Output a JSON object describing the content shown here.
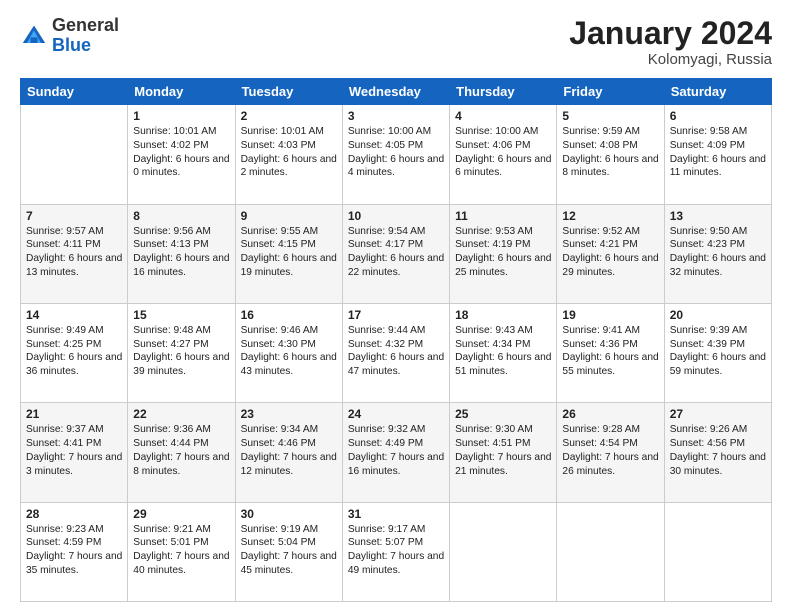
{
  "logo": {
    "general": "General",
    "blue": "Blue"
  },
  "title": "January 2024",
  "location": "Kolomyagi, Russia",
  "days_header": [
    "Sunday",
    "Monday",
    "Tuesday",
    "Wednesday",
    "Thursday",
    "Friday",
    "Saturday"
  ],
  "weeks": [
    [
      {
        "day": "",
        "sunrise": "",
        "sunset": "",
        "daylight": ""
      },
      {
        "day": "1",
        "sunrise": "Sunrise: 10:01 AM",
        "sunset": "Sunset: 4:02 PM",
        "daylight": "Daylight: 6 hours and 0 minutes."
      },
      {
        "day": "2",
        "sunrise": "Sunrise: 10:01 AM",
        "sunset": "Sunset: 4:03 PM",
        "daylight": "Daylight: 6 hours and 2 minutes."
      },
      {
        "day": "3",
        "sunrise": "Sunrise: 10:00 AM",
        "sunset": "Sunset: 4:05 PM",
        "daylight": "Daylight: 6 hours and 4 minutes."
      },
      {
        "day": "4",
        "sunrise": "Sunrise: 10:00 AM",
        "sunset": "Sunset: 4:06 PM",
        "daylight": "Daylight: 6 hours and 6 minutes."
      },
      {
        "day": "5",
        "sunrise": "Sunrise: 9:59 AM",
        "sunset": "Sunset: 4:08 PM",
        "daylight": "Daylight: 6 hours and 8 minutes."
      },
      {
        "day": "6",
        "sunrise": "Sunrise: 9:58 AM",
        "sunset": "Sunset: 4:09 PM",
        "daylight": "Daylight: 6 hours and 11 minutes."
      }
    ],
    [
      {
        "day": "7",
        "sunrise": "Sunrise: 9:57 AM",
        "sunset": "Sunset: 4:11 PM",
        "daylight": "Daylight: 6 hours and 13 minutes."
      },
      {
        "day": "8",
        "sunrise": "Sunrise: 9:56 AM",
        "sunset": "Sunset: 4:13 PM",
        "daylight": "Daylight: 6 hours and 16 minutes."
      },
      {
        "day": "9",
        "sunrise": "Sunrise: 9:55 AM",
        "sunset": "Sunset: 4:15 PM",
        "daylight": "Daylight: 6 hours and 19 minutes."
      },
      {
        "day": "10",
        "sunrise": "Sunrise: 9:54 AM",
        "sunset": "Sunset: 4:17 PM",
        "daylight": "Daylight: 6 hours and 22 minutes."
      },
      {
        "day": "11",
        "sunrise": "Sunrise: 9:53 AM",
        "sunset": "Sunset: 4:19 PM",
        "daylight": "Daylight: 6 hours and 25 minutes."
      },
      {
        "day": "12",
        "sunrise": "Sunrise: 9:52 AM",
        "sunset": "Sunset: 4:21 PM",
        "daylight": "Daylight: 6 hours and 29 minutes."
      },
      {
        "day": "13",
        "sunrise": "Sunrise: 9:50 AM",
        "sunset": "Sunset: 4:23 PM",
        "daylight": "Daylight: 6 hours and 32 minutes."
      }
    ],
    [
      {
        "day": "14",
        "sunrise": "Sunrise: 9:49 AM",
        "sunset": "Sunset: 4:25 PM",
        "daylight": "Daylight: 6 hours and 36 minutes."
      },
      {
        "day": "15",
        "sunrise": "Sunrise: 9:48 AM",
        "sunset": "Sunset: 4:27 PM",
        "daylight": "Daylight: 6 hours and 39 minutes."
      },
      {
        "day": "16",
        "sunrise": "Sunrise: 9:46 AM",
        "sunset": "Sunset: 4:30 PM",
        "daylight": "Daylight: 6 hours and 43 minutes."
      },
      {
        "day": "17",
        "sunrise": "Sunrise: 9:44 AM",
        "sunset": "Sunset: 4:32 PM",
        "daylight": "Daylight: 6 hours and 47 minutes."
      },
      {
        "day": "18",
        "sunrise": "Sunrise: 9:43 AM",
        "sunset": "Sunset: 4:34 PM",
        "daylight": "Daylight: 6 hours and 51 minutes."
      },
      {
        "day": "19",
        "sunrise": "Sunrise: 9:41 AM",
        "sunset": "Sunset: 4:36 PM",
        "daylight": "Daylight: 6 hours and 55 minutes."
      },
      {
        "day": "20",
        "sunrise": "Sunrise: 9:39 AM",
        "sunset": "Sunset: 4:39 PM",
        "daylight": "Daylight: 6 hours and 59 minutes."
      }
    ],
    [
      {
        "day": "21",
        "sunrise": "Sunrise: 9:37 AM",
        "sunset": "Sunset: 4:41 PM",
        "daylight": "Daylight: 7 hours and 3 minutes."
      },
      {
        "day": "22",
        "sunrise": "Sunrise: 9:36 AM",
        "sunset": "Sunset: 4:44 PM",
        "daylight": "Daylight: 7 hours and 8 minutes."
      },
      {
        "day": "23",
        "sunrise": "Sunrise: 9:34 AM",
        "sunset": "Sunset: 4:46 PM",
        "daylight": "Daylight: 7 hours and 12 minutes."
      },
      {
        "day": "24",
        "sunrise": "Sunrise: 9:32 AM",
        "sunset": "Sunset: 4:49 PM",
        "daylight": "Daylight: 7 hours and 16 minutes."
      },
      {
        "day": "25",
        "sunrise": "Sunrise: 9:30 AM",
        "sunset": "Sunset: 4:51 PM",
        "daylight": "Daylight: 7 hours and 21 minutes."
      },
      {
        "day": "26",
        "sunrise": "Sunrise: 9:28 AM",
        "sunset": "Sunset: 4:54 PM",
        "daylight": "Daylight: 7 hours and 26 minutes."
      },
      {
        "day": "27",
        "sunrise": "Sunrise: 9:26 AM",
        "sunset": "Sunset: 4:56 PM",
        "daylight": "Daylight: 7 hours and 30 minutes."
      }
    ],
    [
      {
        "day": "28",
        "sunrise": "Sunrise: 9:23 AM",
        "sunset": "Sunset: 4:59 PM",
        "daylight": "Daylight: 7 hours and 35 minutes."
      },
      {
        "day": "29",
        "sunrise": "Sunrise: 9:21 AM",
        "sunset": "Sunset: 5:01 PM",
        "daylight": "Daylight: 7 hours and 40 minutes."
      },
      {
        "day": "30",
        "sunrise": "Sunrise: 9:19 AM",
        "sunset": "Sunset: 5:04 PM",
        "daylight": "Daylight: 7 hours and 45 minutes."
      },
      {
        "day": "31",
        "sunrise": "Sunrise: 9:17 AM",
        "sunset": "Sunset: 5:07 PM",
        "daylight": "Daylight: 7 hours and 49 minutes."
      },
      {
        "day": "",
        "sunrise": "",
        "sunset": "",
        "daylight": ""
      },
      {
        "day": "",
        "sunrise": "",
        "sunset": "",
        "daylight": ""
      },
      {
        "day": "",
        "sunrise": "",
        "sunset": "",
        "daylight": ""
      }
    ]
  ]
}
